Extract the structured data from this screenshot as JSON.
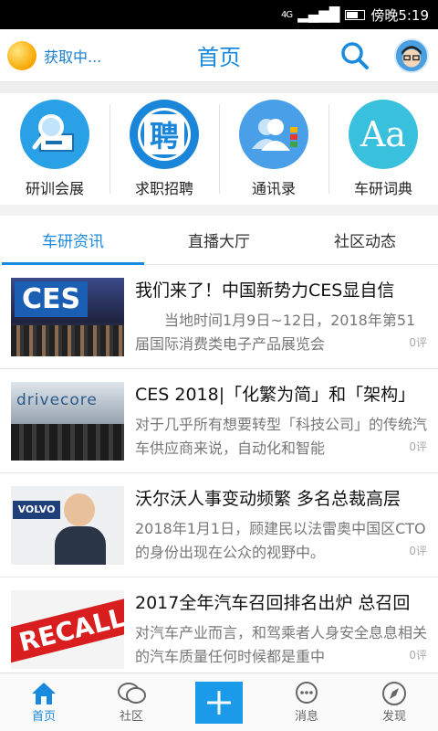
{
  "status_bar": {
    "network": "4G",
    "time": "傍晚5:19"
  },
  "header": {
    "location": "获取中...",
    "title": "首页"
  },
  "quick_links": [
    {
      "label": "研训会展",
      "icon": "magnifier-card-icon",
      "color": "#2aa1e6"
    },
    {
      "label": "求职招聘",
      "icon": "recruit-icon",
      "glyph": "聘",
      "color": "#1a86d9"
    },
    {
      "label": "通讯录",
      "icon": "contacts-icon",
      "color": "#4aa0e8"
    },
    {
      "label": "车研词典",
      "icon": "dictionary-icon",
      "glyph": "Aa",
      "color": "#38c0dc"
    }
  ],
  "tabs": [
    {
      "label": "车研资讯",
      "active": true
    },
    {
      "label": "直播大厅",
      "active": false
    },
    {
      "label": "社区动态",
      "active": false
    }
  ],
  "news": [
    {
      "title": "我们来了！中国新势力CES显自信",
      "summary": "　　当地时间1月9日~12日，2018年第51届国际消费类电子产品展览会",
      "count": "0评",
      "thumb_text": "CES"
    },
    {
      "title": "CES 2018|「化繁为简」和「架构」",
      "summary": "对于几乎所有想要转型「科技公司」的传统汽车供应商来说，自动化和智能",
      "count": "0评",
      "thumb_text": "drivecore"
    },
    {
      "title": "沃尔沃人事变动频繁 多名总裁高层",
      "summary": "2018年1月1日，顾建民以法雷奥中国区CTO的身份出现在公众的视野中。",
      "count": "0评",
      "thumb_text": "VOLVO"
    },
    {
      "title": "2017全年汽车召回排名出炉 总召回",
      "summary": "对汽车产业而言，和驾乘者人身安全息息相关的汽车质量任何时候都是重中",
      "count": "0评",
      "thumb_text": "RECALL"
    }
  ],
  "bottom_nav": [
    {
      "label": "首页",
      "icon": "home-icon",
      "active": true
    },
    {
      "label": "社区",
      "icon": "chat-bubbles-icon",
      "active": false
    },
    {
      "label": "",
      "icon": "plus-icon",
      "active": false
    },
    {
      "label": "消息",
      "icon": "message-icon",
      "active": false
    },
    {
      "label": "发现",
      "icon": "compass-icon",
      "active": false
    }
  ],
  "colors": {
    "accent": "#1a8ae0"
  }
}
